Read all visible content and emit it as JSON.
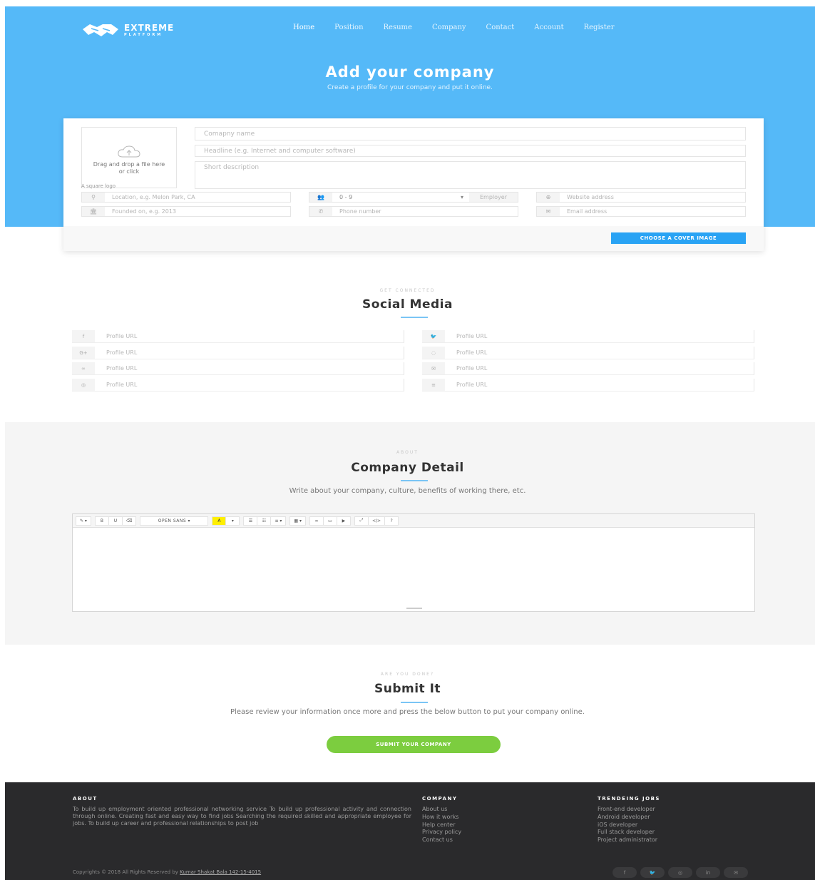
{
  "brand": {
    "line1": "EXTREME",
    "line2": "PLATFORM"
  },
  "nav": [
    "Home",
    "Position",
    "Resume",
    "Company",
    "Contact",
    "Account",
    "Register"
  ],
  "hero": {
    "title": "Add your company",
    "subtitle": "Create a profile for your company and put it online."
  },
  "form": {
    "logo_drop_text": "Drag and drop a file here or click",
    "logo_hint": "A square logo",
    "company_name_placeholder": "Comapny name",
    "headline_placeholder": "Headline (e.g. Internet and computer software)",
    "description_placeholder": "Short description",
    "location_placeholder": "Location, e.g. Melon Park, CA",
    "employees_value": "0 - 9",
    "employees_addon": "Employer",
    "website_placeholder": "Website address",
    "founded_placeholder": "Founded on, e.g. 2013",
    "phone_placeholder": "Phone number",
    "email_placeholder": "Email address",
    "cover_button": "CHOOSE A COVER IMAGE"
  },
  "social": {
    "kicker": "GET CONNECTED",
    "title": "Social Media",
    "fields": [
      {
        "icon": "facebook-icon",
        "glyph": "f",
        "placeholder": "Profile URL"
      },
      {
        "icon": "twitter-icon",
        "glyph": "🐦",
        "placeholder": "Profile URL"
      },
      {
        "icon": "google-plus-icon",
        "glyph": "G+",
        "placeholder": "Profile URL"
      },
      {
        "icon": "github-icon",
        "glyph": "◌",
        "placeholder": "Profile URL"
      },
      {
        "icon": "flickr-icon",
        "glyph": "∞",
        "placeholder": "Profile URL"
      },
      {
        "icon": "envelope-icon",
        "glyph": "✉",
        "placeholder": "Profile URL"
      },
      {
        "icon": "dribbble-icon",
        "glyph": "◎",
        "placeholder": "Profile URL"
      },
      {
        "icon": "stackoverflow-icon",
        "glyph": "≡",
        "placeholder": "Profile URL"
      }
    ]
  },
  "detail": {
    "kicker": "ABOUT",
    "title": "Company Detail",
    "lead": "Write about your company, culture, benefits of working there, etc.",
    "toolbar": {
      "style": "✎ ▾",
      "bold": "B",
      "underline": "U",
      "eraser": "⌫",
      "font": "OPEN SANS ▾",
      "color": "A",
      "color_caret": "▾",
      "ul": "☰",
      "ol": "☷",
      "para": "≡ ▾",
      "table": "▦ ▾",
      "link": "∞",
      "picture": "▭",
      "video": "▶",
      "fullscreen": "⤢",
      "code": "</>",
      "help": "?"
    }
  },
  "submit": {
    "kicker": "ARE YOU DONE?",
    "title": "Submit It",
    "lead": "Please review your information once more and press the below button to put your company online.",
    "button": "SUBMIT YOUR COMPANY"
  },
  "footer": {
    "about_title": "ABOUT",
    "about_text": "To build up employment oriented professional networking service To build up professional activity and connection through online. Creating fast and easy way to find jobs Searching the required skilled and appropriate employee for jobs. To build up career and professional relationships to post job",
    "company_title": "COMPANY",
    "company_links": [
      "About us",
      "How it works",
      "Help center",
      "Privacy policy",
      "Contact us"
    ],
    "jobs_title": "TRENDEING JOBS",
    "jobs_links": [
      "Front-end developer",
      "Android developer",
      "iOS developer",
      "Full stack developer",
      "Project administrator"
    ],
    "copyright_prefix": "Copyrights © 2018 All Rights Reserved by ",
    "copyright_name": "Kumar Shakat Bala 142-15-4015",
    "social_icons": [
      "f",
      "🐦",
      "◎",
      "in",
      "✉"
    ]
  }
}
